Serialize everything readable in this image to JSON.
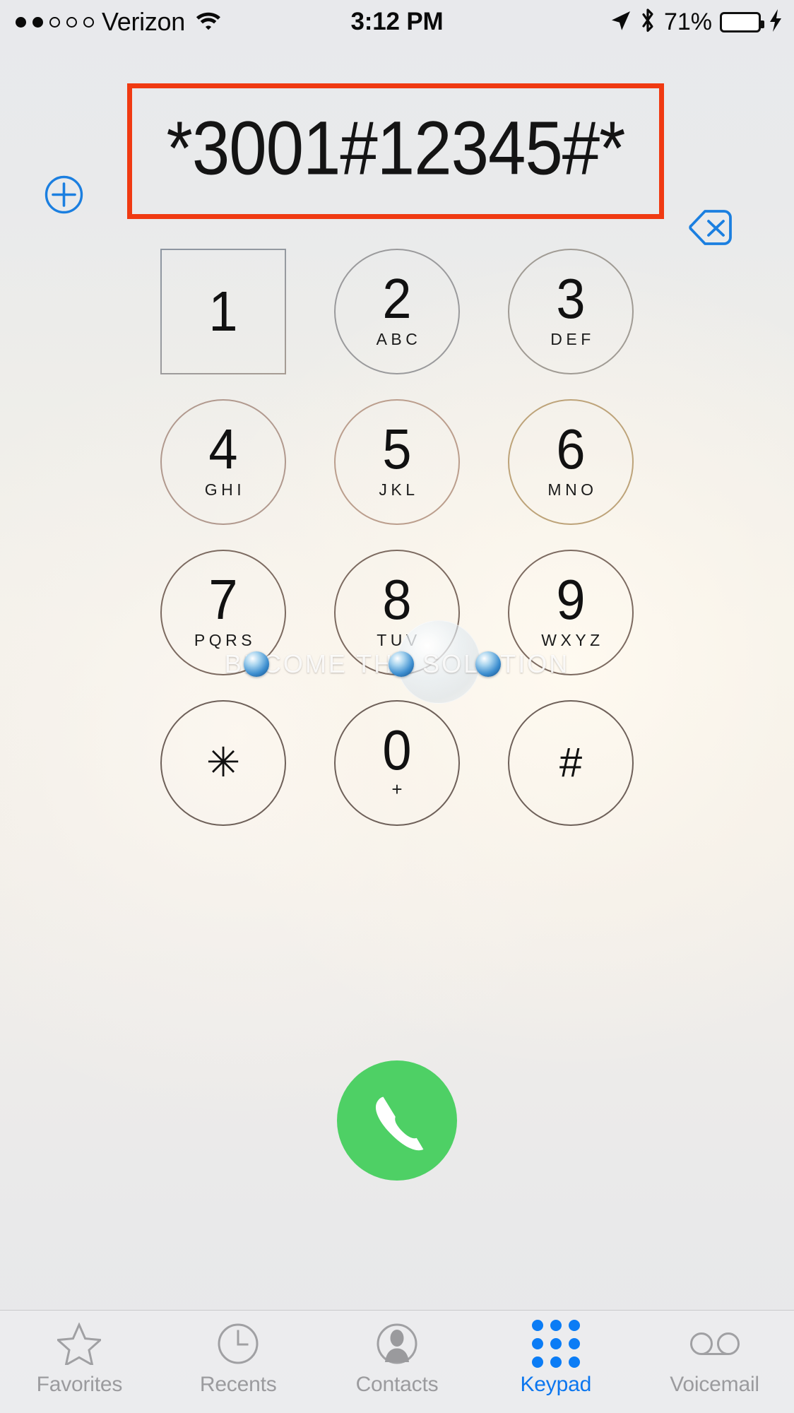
{
  "status_bar": {
    "signal_dots_filled": 2,
    "signal_dots_total": 5,
    "carrier": "Verizon",
    "wifi_icon": "wifi-icon",
    "time": "3:12 PM",
    "location_icon": "location-arrow-icon",
    "bluetooth_icon": "bluetooth-icon",
    "battery_percent": "71%",
    "battery_level": 71,
    "charging_icon": "lightning-bolt-icon"
  },
  "display": {
    "number": "*3001#12345#*",
    "placeholder": "",
    "add_contact_icon": "add-contact-plus-circle-icon",
    "backspace_icon": "backspace-delete-icon",
    "annotation": {
      "shape": "rectangle",
      "color": "#f03a12"
    },
    "accent_blue": "#0b76ef"
  },
  "keypad": {
    "rows": [
      [
        {
          "digit": "1",
          "letters": ""
        },
        {
          "digit": "2",
          "letters": "ABC"
        },
        {
          "digit": "3",
          "letters": "DEF"
        }
      ],
      [
        {
          "digit": "4",
          "letters": "GHI"
        },
        {
          "digit": "5",
          "letters": "JKL"
        },
        {
          "digit": "6",
          "letters": "MNO"
        }
      ],
      [
        {
          "digit": "7",
          "letters": "PQRS"
        },
        {
          "digit": "8",
          "letters": "TUV"
        },
        {
          "digit": "9",
          "letters": "WXYZ"
        }
      ],
      [
        {
          "digit": "✳",
          "letters": ""
        },
        {
          "digit": "0",
          "letters": "+"
        },
        {
          "digit": "#",
          "letters": ""
        }
      ]
    ]
  },
  "call_button": {
    "icon": "phone-handset-icon",
    "color": "#4ed065",
    "label": ""
  },
  "watermark": {
    "text": "BECOME THE SOLUTION"
  },
  "tab_bar": {
    "items": [
      {
        "label": "Favorites",
        "icon": "star-icon",
        "active": false
      },
      {
        "label": "Recents",
        "icon": "clock-icon",
        "active": false
      },
      {
        "label": "Contacts",
        "icon": "person-icon",
        "active": false
      },
      {
        "label": "Keypad",
        "icon": "keypad-dots-icon",
        "active": true
      },
      {
        "label": "Voicemail",
        "icon": "voicemail-icon",
        "active": false
      }
    ],
    "active_color": "#0b76ef",
    "inactive_color": "#9b9b9e"
  }
}
